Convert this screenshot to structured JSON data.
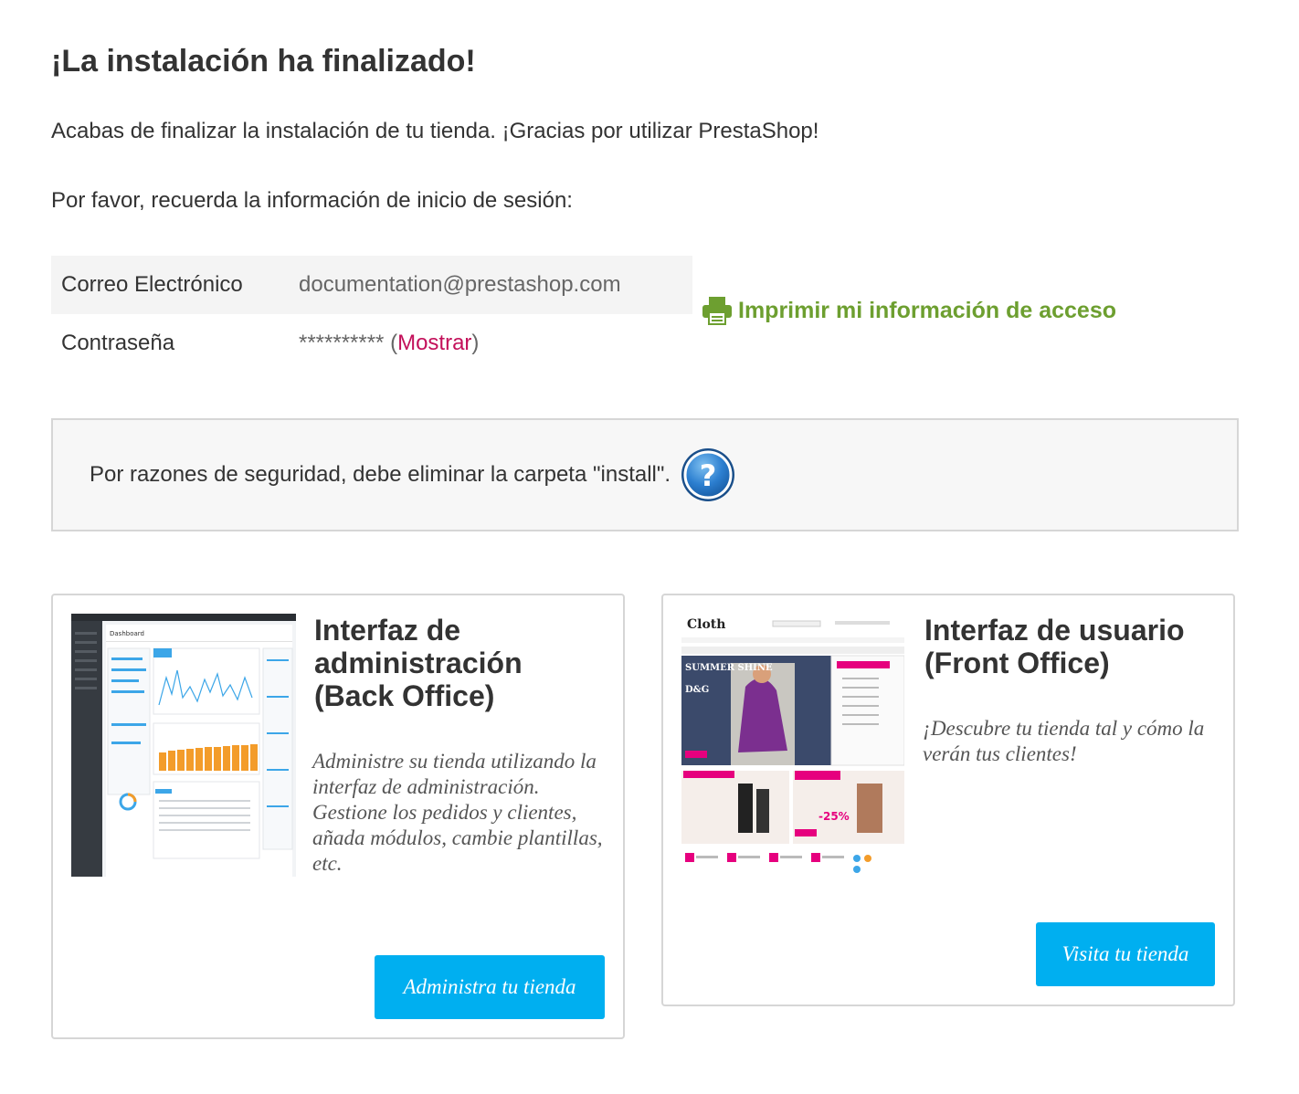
{
  "title": "¡La instalación ha finalizado!",
  "intro": "Acabas de finalizar la instalación de tu tienda. ¡Gracias por utilizar PrestaShop!",
  "remember": "Por favor, recuerda la información de inicio de sesión:",
  "credentials": {
    "email_label": "Correo Electrónico",
    "email_value": "documentation@prestashop.com",
    "password_label": "Contraseña",
    "password_value": "**********",
    "show_label": "Mostrar"
  },
  "print": {
    "label": "Imprimir mi información de acceso",
    "icon": "printer-icon"
  },
  "security": {
    "text": "Por razones de seguridad, debe eliminar la carpeta \"install\".",
    "icon": "help-icon"
  },
  "back_office": {
    "title": "Interfaz de administración (Back Office)",
    "description": "Administre su tienda utilizando la interfaz de administración. Gestione los pedidos y clientes, añada módulos, cambie plantillas, etc.",
    "button": "Administra tu tienda",
    "thumb_heading": "Dashboard"
  },
  "front_office": {
    "title": "Interfaz de usuario (Front Office)",
    "description": "¡Descubre tu tienda tal y cómo la verán tus clientes!",
    "button": "Visita tu tienda",
    "thumb_logo": "Cloth",
    "thumb_banner": "SUMMER SHINE",
    "thumb_brand": "D&G",
    "thumb_sale": "-25%"
  },
  "colors": {
    "accent": "#00aff0",
    "link": "#c3105a",
    "print": "#6d9f30"
  }
}
